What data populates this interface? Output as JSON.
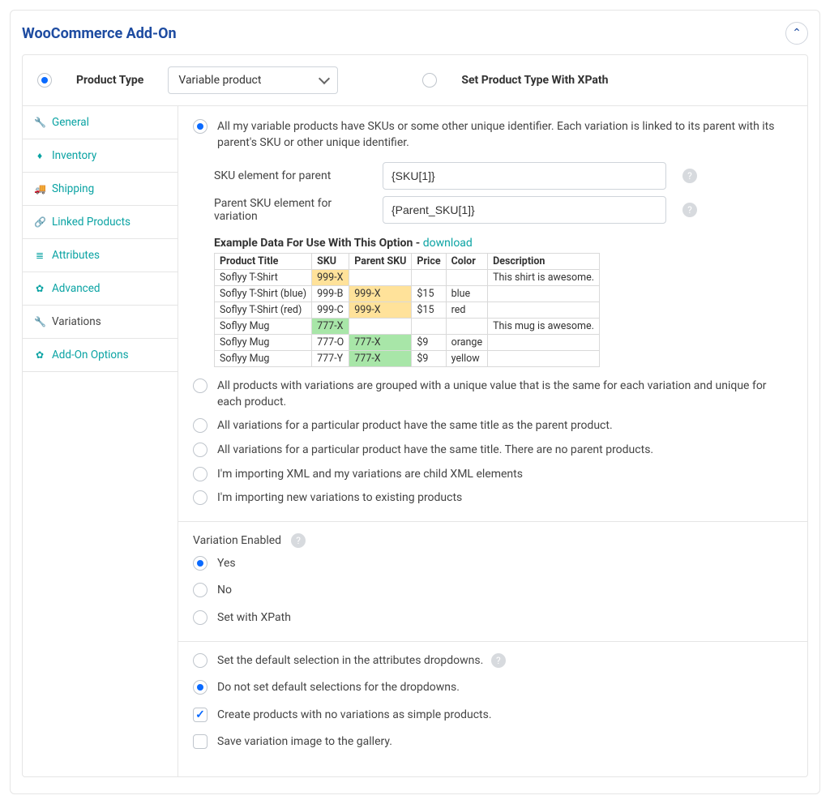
{
  "header": {
    "title": "WooCommerce Add-On"
  },
  "topRow": {
    "productTypeLabel": "Product Type",
    "productTypeSelected": true,
    "selectValue": "Variable product",
    "xpathLabel": "Set Product Type With XPath",
    "xpathSelected": false
  },
  "sidebar": [
    {
      "name": "general",
      "label": "General",
      "icon": "🔧",
      "active": false
    },
    {
      "name": "inventory",
      "label": "Inventory",
      "icon": "♦",
      "active": false
    },
    {
      "name": "shipping",
      "label": "Shipping",
      "icon": "🚚",
      "active": false
    },
    {
      "name": "linked",
      "label": "Linked Products",
      "icon": "🔗",
      "active": false
    },
    {
      "name": "attributes",
      "label": "Attributes",
      "icon": "≣",
      "active": false
    },
    {
      "name": "advanced",
      "label": "Advanced",
      "icon": "✿",
      "active": false
    },
    {
      "name": "variations",
      "label": "Variations",
      "icon": "🔧",
      "active": true
    },
    {
      "name": "addon",
      "label": "Add-On Options",
      "icon": "✿",
      "active": false
    }
  ],
  "options": {
    "main": [
      {
        "key": "opt0",
        "selected": true,
        "text": "All my variable products have SKUs or some other unique identifier. Each variation is linked to its parent with its parent's SKU or other unique identifier."
      },
      {
        "key": "opt1",
        "selected": false,
        "text": "All products with variations are grouped with a unique value that is the same for each variation and unique for each product."
      },
      {
        "key": "opt2",
        "selected": false,
        "text": "All variations for a particular product have the same title as the parent product."
      },
      {
        "key": "opt3",
        "selected": false,
        "text": "All variations for a particular product have the same title. There are no parent products."
      },
      {
        "key": "opt4",
        "selected": false,
        "text": "I'm importing XML and my variations are child XML elements"
      },
      {
        "key": "opt5",
        "selected": false,
        "text": "I'm importing new variations to existing products"
      }
    ],
    "skuFields": {
      "parentLabel": "SKU element for parent",
      "parentValue": "{SKU[1]}",
      "variationLabel": "Parent SKU element for variation",
      "variationValue": "{Parent_SKU[1]}"
    },
    "exampleTitlePrefix": "Example Data For Use With This Option - ",
    "exampleDownload": "download",
    "exampleHeaders": [
      "Product Title",
      "SKU",
      "Parent SKU",
      "Price",
      "Color",
      "Description"
    ],
    "exampleRows": [
      {
        "title": "Soflyy T-Shirt",
        "sku": "999-X",
        "skuClass": "hl-y",
        "psku": "",
        "pskuClass": "",
        "price": "",
        "color": "",
        "desc": "This shirt is awesome."
      },
      {
        "title": "Soflyy T-Shirt (blue)",
        "sku": "999-B",
        "skuClass": "",
        "psku": "999-X",
        "pskuClass": "hl-y",
        "price": "$15",
        "color": "blue",
        "desc": ""
      },
      {
        "title": "Soflyy T-Shirt (red)",
        "sku": "999-C",
        "skuClass": "",
        "psku": "999-X",
        "pskuClass": "hl-y",
        "price": "$15",
        "color": "red",
        "desc": ""
      },
      {
        "title": "Soflyy Mug",
        "sku": "777-X",
        "skuClass": "hl-g",
        "psku": "",
        "pskuClass": "",
        "price": "",
        "color": "",
        "desc": "This mug is awesome."
      },
      {
        "title": "Soflyy Mug",
        "sku": "777-O",
        "skuClass": "",
        "psku": "777-X",
        "pskuClass": "hl-g",
        "price": "$9",
        "color": "orange",
        "desc": ""
      },
      {
        "title": "Soflyy Mug",
        "sku": "777-Y",
        "skuClass": "",
        "psku": "777-X",
        "pskuClass": "hl-g",
        "price": "$9",
        "color": "yellow",
        "desc": ""
      }
    ]
  },
  "variationEnabled": {
    "label": "Variation Enabled",
    "choices": [
      {
        "text": "Yes",
        "selected": true
      },
      {
        "text": "No",
        "selected": false
      },
      {
        "text": "Set with XPath",
        "selected": false
      }
    ]
  },
  "bottomOptions": [
    {
      "type": "radio",
      "selected": false,
      "text": "Set the default selection in the attributes dropdowns.",
      "help": true
    },
    {
      "type": "radio",
      "selected": true,
      "text": "Do not set default selections for the dropdowns."
    },
    {
      "type": "checkbox",
      "selected": true,
      "text": "Create products with no variations as simple products."
    },
    {
      "type": "checkbox",
      "selected": false,
      "text": "Save variation image to the gallery."
    }
  ]
}
